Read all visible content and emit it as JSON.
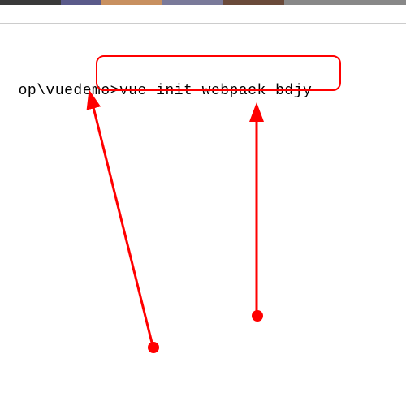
{
  "terminal": {
    "prompt_path": "op\\vuedemo>",
    "command": "vue init webpack bdjy"
  },
  "annotations": {
    "highlight_color": "#ff0000",
    "arrow_color": "#ff0000"
  }
}
